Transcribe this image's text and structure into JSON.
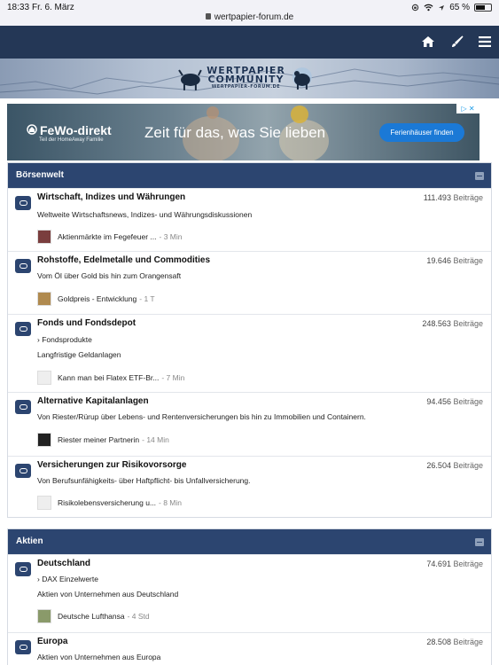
{
  "status": {
    "time": "18:33",
    "date": "Fr. 6. März",
    "url": "wertpapier-forum.de",
    "battery": "65 %",
    "battery_level": 0.65
  },
  "nav": {
    "icons": [
      "home-icon",
      "brush-icon",
      "menu-icon"
    ]
  },
  "banner": {
    "logo_line1": "WERTPAPIER",
    "logo_line2": "COMMUNITY",
    "logo_line3": "WERTPAPIER-FORUM.DE"
  },
  "ad": {
    "brand": "FeWo-direkt",
    "brand_sub": "Teil der HomeAway Familie",
    "slogan": "Zeit für das, was Sie lieben",
    "cta": "Ferienhäuser finden"
  },
  "categories": [
    {
      "title": "Börsenwelt",
      "forums": [
        {
          "title": "Wirtschaft, Indizes und Währungen",
          "count": "111.493",
          "count_label": "Beiträge",
          "desc": "Weltweite Wirtschaftsnews, Indizes- und Währungsdiskussionen",
          "last_post": "Aktienmärkte im Fegefeuer ...",
          "last_time": "- 3 Min",
          "avatar_color": "#7a3e3e"
        },
        {
          "title": "Rohstoffe, Edelmetalle und Commodities",
          "count": "19.646",
          "count_label": "Beiträge",
          "desc": "Vom Öl über Gold bis hin zum Orangensaft",
          "last_post": "Goldpreis - Entwicklung",
          "last_time": "- 1 T",
          "avatar_color": "#b08a4f"
        },
        {
          "title": "Fonds und Fondsdepot",
          "count": "248.563",
          "count_label": "Beiträge",
          "sub": "› Fondsprodukte",
          "desc": "Langfristige Geldanlagen",
          "last_post": "Kann man bei Flatex ETF-Br...",
          "last_time": "- 7 Min",
          "avatar_color": "#eeeeee"
        },
        {
          "title": "Alternative Kapitalanlagen",
          "count": "94.456",
          "count_label": "Beiträge",
          "desc": "Von Riester/Rürup über Lebens- und Rentenversicherungen bis hin zu Immobilien und Containern.",
          "last_post": "Riester meiner Partnerin",
          "last_time": "- 14 Min",
          "avatar_color": "#222222"
        },
        {
          "title": "Versicherungen zur Risikovorsorge",
          "count": "26.504",
          "count_label": "Beiträge",
          "desc": "Von Berufsunfähigkeits- über Haftpflicht- bis Unfallversicherung.",
          "last_post": "Risikolebensversicherung u...",
          "last_time": "- 8 Min",
          "avatar_color": "#eeeeee"
        }
      ]
    },
    {
      "title": "Aktien",
      "forums": [
        {
          "title": "Deutschland",
          "count": "74.691",
          "count_label": "Beiträge",
          "sub": "› DAX Einzelwerte",
          "desc": "Aktien von Unternehmen aus Deutschland",
          "last_post": "Deutsche Lufthansa",
          "last_time": "- 4 Std",
          "avatar_color": "#8a9a6a"
        },
        {
          "title": "Europa",
          "count": "28.508",
          "count_label": "Beiträge",
          "desc": "Aktien von Unternehmen aus Europa"
        }
      ]
    }
  ]
}
